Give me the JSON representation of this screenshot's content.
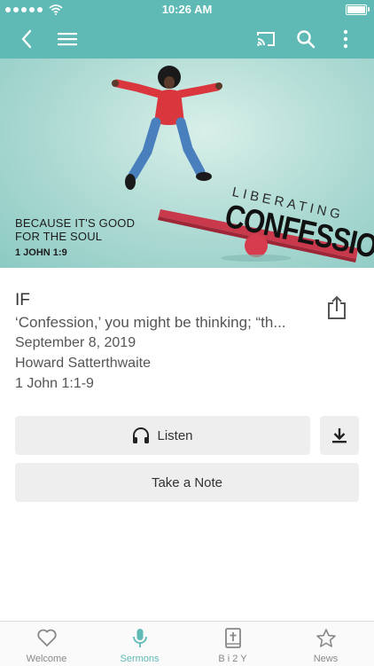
{
  "status_bar": {
    "time": "10:26 AM"
  },
  "hero": {
    "tagline_line1": "BECAUSE IT'S GOOD",
    "tagline_line2": "FOR THE SOUL",
    "reference": "1 JOHN 1:9",
    "series_small": "LIBERATING",
    "series_big": "CONFESSION"
  },
  "sermon": {
    "title": "IF",
    "excerpt": "‘Confession,’ you might be thinking; “th...",
    "date": "September 8, 2019",
    "speaker": "Howard Satterthwaite",
    "passage": "1 John 1:1-9"
  },
  "actions": {
    "listen_label": "Listen",
    "note_label": "Take a Note"
  },
  "tabs": [
    {
      "label": "Welcome",
      "icon": "heart-icon"
    },
    {
      "label": "Sermons",
      "icon": "microphone-icon",
      "active": true
    },
    {
      "label": "B i 2 Y",
      "icon": "bible-icon"
    },
    {
      "label": "News",
      "icon": "star-icon"
    }
  ],
  "colors": {
    "accent": "#5fb9b5",
    "button_bg": "#eeeeee"
  }
}
